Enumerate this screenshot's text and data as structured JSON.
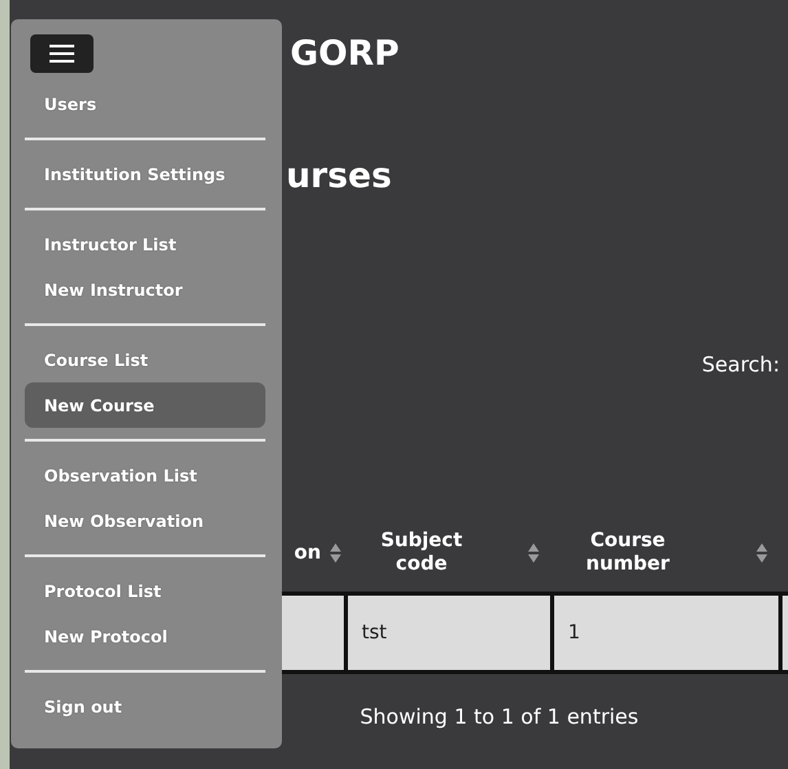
{
  "app_title": "GORP",
  "page_heading": "urses",
  "search_label": "Search:",
  "table": {
    "columns": [
      {
        "label": "on"
      },
      {
        "label": "Subject code"
      },
      {
        "label": "Course number"
      }
    ],
    "rows": [
      {
        "cells": [
          null,
          "tst",
          "1"
        ]
      }
    ]
  },
  "table_info": "Showing 1 to 1 of 1 entries",
  "menu": {
    "groups": [
      {
        "items": [
          {
            "label": "Users",
            "selected": false
          }
        ]
      },
      {
        "items": [
          {
            "label": "Institution Settings",
            "selected": false
          }
        ]
      },
      {
        "items": [
          {
            "label": "Instructor List",
            "selected": false
          },
          {
            "label": "New Instructor",
            "selected": false
          }
        ]
      },
      {
        "items": [
          {
            "label": "Course List",
            "selected": false
          },
          {
            "label": "New Course",
            "selected": true
          }
        ]
      },
      {
        "items": [
          {
            "label": "Observation List",
            "selected": false
          },
          {
            "label": "New Observation",
            "selected": false
          }
        ]
      },
      {
        "items": [
          {
            "label": "Protocol List",
            "selected": false
          },
          {
            "label": "New Protocol",
            "selected": false
          }
        ]
      },
      {
        "items": [
          {
            "label": "Sign out",
            "selected": false
          }
        ]
      }
    ]
  }
}
